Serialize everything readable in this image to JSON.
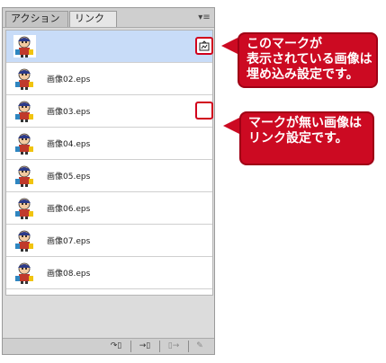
{
  "panel": {
    "tabs": [
      {
        "label": "アクション"
      },
      {
        "label": "リンク",
        "close": "×"
      }
    ],
    "menu_icon": "panel-menu-icon"
  },
  "links": {
    "items": [
      {
        "name": "",
        "selected": true,
        "embedded": true
      },
      {
        "name": "画像02.eps",
        "selected": false,
        "embedded": false
      },
      {
        "name": "画像03.eps",
        "selected": false,
        "embedded": false,
        "outlined_empty": true
      },
      {
        "name": "画像04.eps",
        "selected": false,
        "embedded": false
      },
      {
        "name": "画像05.eps",
        "selected": false,
        "embedded": false
      },
      {
        "name": "画像06.eps",
        "selected": false,
        "embedded": false
      },
      {
        "name": "画像07.eps",
        "selected": false,
        "embedded": false
      },
      {
        "name": "画像08.eps",
        "selected": false,
        "embedded": false
      }
    ]
  },
  "toolbar": {
    "relink": "↷▯",
    "goto": "→▯",
    "update": "▯→",
    "edit": "✎"
  },
  "callouts": {
    "embedded": {
      "line1": "このマークが",
      "line2": "表示されている画像は",
      "line3": "埋め込み設定です。"
    },
    "linked": {
      "line1": "マークが無い画像は",
      "line2": "リンク設定です。"
    }
  },
  "colors": {
    "accent_red": "#cc0a22",
    "selected_row": "#c8dcf8"
  }
}
